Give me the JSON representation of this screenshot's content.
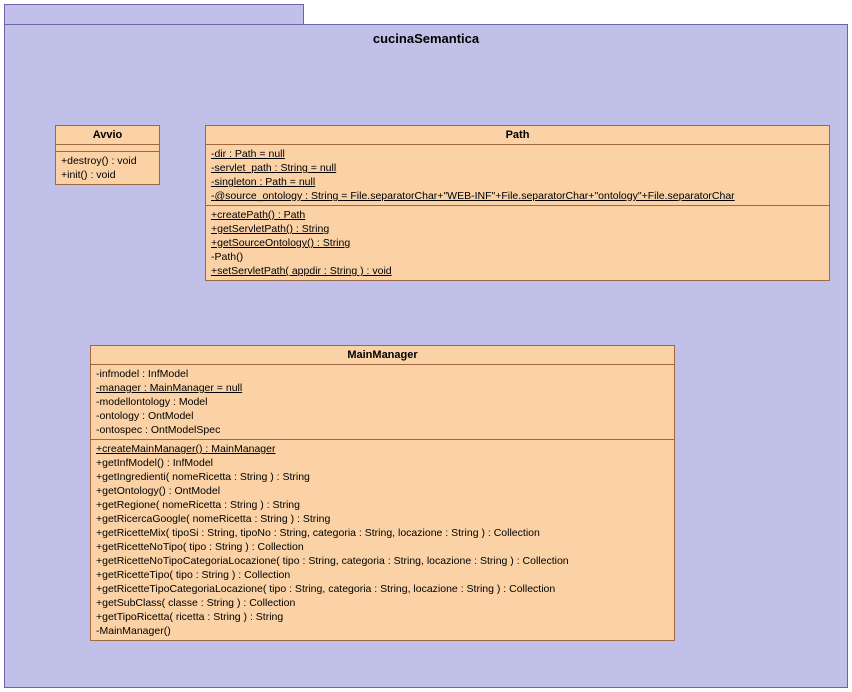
{
  "package": {
    "name": "cucinaSemantica"
  },
  "classes": {
    "avvio": {
      "name": "Avvio",
      "attributes": [],
      "operations": [
        {
          "text": "+destroy() : void",
          "static": false
        },
        {
          "text": "+init() : void",
          "static": false
        }
      ]
    },
    "path": {
      "name": "Path",
      "attributes": [
        {
          "text": "-dir : Path = null",
          "static": true
        },
        {
          "text": "-servlet_path : String = null",
          "static": true
        },
        {
          "text": "-singleton : Path = null",
          "static": true
        },
        {
          "text": "-@source_ontology : String = File.separatorChar+\"WEB-INF\"+File.separatorChar+\"ontology\"+File.separatorChar",
          "static": true
        }
      ],
      "operations": [
        {
          "text": "+createPath() : Path",
          "static": true
        },
        {
          "text": "+getServletPath() : String",
          "static": true
        },
        {
          "text": "+getSourceOntology() : String",
          "static": true
        },
        {
          "text": "-Path()",
          "static": false
        },
        {
          "text": "+setServletPath( appdir : String ) : void",
          "static": true
        }
      ]
    },
    "mainmanager": {
      "name": "MainManager",
      "attributes": [
        {
          "text": "-infmodel : InfModel",
          "static": false
        },
        {
          "text": "-manager : MainManager = null",
          "static": true
        },
        {
          "text": "-modellontology : Model",
          "static": false
        },
        {
          "text": "-ontology : OntModel",
          "static": false
        },
        {
          "text": "-ontospec : OntModelSpec",
          "static": false
        }
      ],
      "operations": [
        {
          "text": "+createMainManager() : MainManager",
          "static": true
        },
        {
          "text": "+getInfModel() : InfModel",
          "static": false
        },
        {
          "text": "+getIngredienti( nomeRicetta : String ) : String",
          "static": false
        },
        {
          "text": "+getOntology() : OntModel",
          "static": false
        },
        {
          "text": "+getRegione( nomeRicetta : String ) : String",
          "static": false
        },
        {
          "text": "+getRicercaGoogle( nomeRicetta : String ) : String",
          "static": false
        },
        {
          "text": "+getRicetteMix( tipoSi : String, tipoNo : String, categoria : String, locazione : String ) : Collection",
          "static": false
        },
        {
          "text": "+getRicetteNoTipo( tipo : String ) : Collection",
          "static": false
        },
        {
          "text": "+getRicetteNoTipoCategoriaLocazione( tipo : String, categoria : String, locazione : String ) : Collection",
          "static": false
        },
        {
          "text": "+getRicetteTipo( tipo : String ) : Collection",
          "static": false
        },
        {
          "text": "+getRicetteTipoCategoriaLocazione( tipo : String, categoria : String, locazione : String ) : Collection",
          "static": false
        },
        {
          "text": "+getSubClass( classe : String ) : Collection",
          "static": false
        },
        {
          "text": "+getTipoRicetta( ricetta : String ) : String",
          "static": false
        },
        {
          "text": "-MainManager()",
          "static": false
        }
      ]
    }
  }
}
